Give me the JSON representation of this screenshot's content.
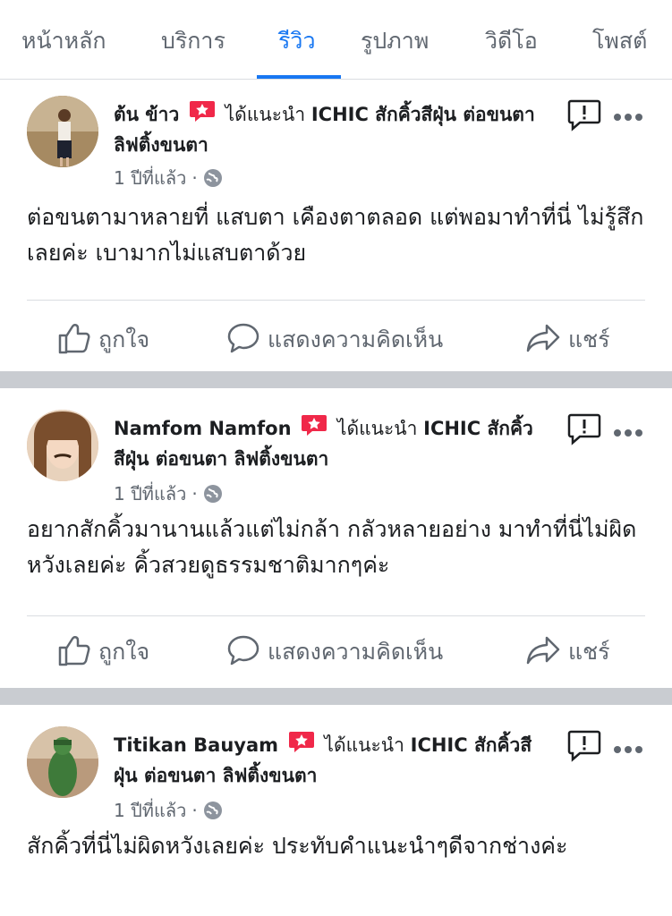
{
  "tabs": [
    {
      "label": "หน้าหลัก"
    },
    {
      "label": "บริการ"
    },
    {
      "label": "รีวิว"
    },
    {
      "label": "รูปภาพ"
    },
    {
      "label": "วิดีโอ"
    },
    {
      "label": "โพสต์"
    }
  ],
  "active_tab": "รีวิว",
  "colors": {
    "accent": "#1877f2",
    "recommend": "#f02849",
    "muted": "#606770",
    "separator": "#c9ccd1"
  },
  "posts": [
    {
      "name": "ต้น ข้าว",
      "recommend_text": "ได้แนะนำ",
      "page": "ICHIC สักคิ้วสีฝุ่น ต่อขนตา ลิฟติ้งขนตา",
      "time": "1 ปีที่แล้ว",
      "text": "ต่อขนตามาหลายที่ แสบตา เคืองตาตลอด แต่พอมาทำที่นี่ ไม่รู้สึกเลยค่ะ เบามากไม่แสบตาด้วย"
    },
    {
      "name": "Namfom Namfon",
      "recommend_text": "ได้แนะนำ",
      "page": "ICHIC สักคิ้วสีฝุ่น ต่อขนตา ลิฟติ้งขนตา",
      "time": "1 ปีที่แล้ว",
      "text": "อยากสักคิ้วมานานแล้วแต่ไม่กล้า กลัวหลายอย่าง มาทำที่นี่ไม่ผิดหวังเลยค่ะ คิ้วสวยดูธรรมชาติมากๆค่ะ"
    },
    {
      "name": "Titikan Bauyam",
      "recommend_text": "ได้แนะนำ",
      "page": "ICHIC สักคิ้วสีฝุ่น ต่อขนตา ลิฟติ้งขนตา",
      "time": "1 ปีที่แล้ว",
      "text": "สักคิ้วที่นี่ไม่ผิดหวังเลยค่ะ ประทับคำแนะนำๆดีจากช่างค่ะ"
    }
  ],
  "actions": {
    "like": "ถูกใจ",
    "comment": "แสดงความคิดเห็น",
    "share": "แชร์"
  },
  "icons": {
    "recommend": "recommend-star-icon",
    "globe": "globe-icon",
    "feedback": "feedback-flag-icon",
    "more": "more-dots-icon"
  }
}
